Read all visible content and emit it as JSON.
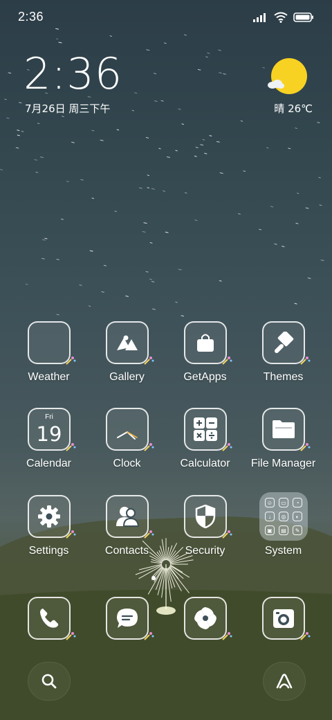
{
  "status_bar": {
    "time": "2:36",
    "icons": [
      "cellular-signal-icon",
      "wifi-icon",
      "battery-icon"
    ]
  },
  "clock_widget": {
    "time": "2:36",
    "date": "7月26日 周三下午"
  },
  "weather_widget": {
    "icon": "sun-with-cloud-icon",
    "text": "晴 26℃",
    "sun_color": "#f8d222"
  },
  "apps": [
    {
      "label": "Weather",
      "icon": "weather-icon"
    },
    {
      "label": "Gallery",
      "icon": "gallery-icon"
    },
    {
      "label": "GetApps",
      "icon": "shopping-bag-icon"
    },
    {
      "label": "Themes",
      "icon": "paint-brush-icon"
    },
    {
      "label": "Calendar",
      "icon": "calendar-icon",
      "day_label": "Fri",
      "day_number": "19"
    },
    {
      "label": "Clock",
      "icon": "clock-icon"
    },
    {
      "label": "Calculator",
      "icon": "calculator-icon"
    },
    {
      "label": "File Manager",
      "icon": "folder-icon"
    },
    {
      "label": "Settings",
      "icon": "gear-icon"
    },
    {
      "label": "Contacts",
      "icon": "contacts-icon"
    },
    {
      "label": "Security",
      "icon": "shield-icon"
    },
    {
      "label": "System",
      "icon": "folder-grid-icon"
    }
  ],
  "dock": [
    {
      "icon": "phone-icon"
    },
    {
      "icon": "messages-icon"
    },
    {
      "icon": "aperture-icon"
    },
    {
      "icon": "camera-icon"
    }
  ],
  "bottom_bar": {
    "left_icon": "search-icon",
    "right_icon": "app-vault-icon"
  }
}
